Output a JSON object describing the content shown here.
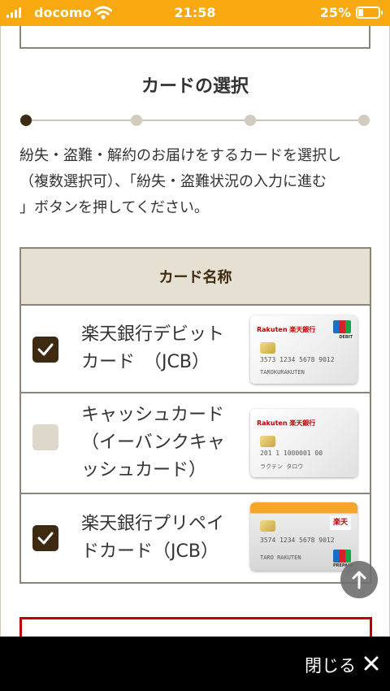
{
  "status_bar": {
    "carrier": "docomo",
    "time": "21:58",
    "battery_percent": "25%",
    "battery_level": 0.25,
    "accent_color": "#f8a90f"
  },
  "page": {
    "section_title": "カードの選択",
    "stepper": {
      "total_steps": 4,
      "current_step": 1
    },
    "instructions": [
      "紛失・盗難・解約のお届けをするカードを選択し",
      "（複数選択可）、「紛失・盗難状況の入力に進む",
      "」ボタンを押してください。"
    ]
  },
  "card_table": {
    "header": "カード名称",
    "rows": [
      {
        "name_lines": [
          "楽天銀行デビット",
          "カード　（JCB）"
        ],
        "checked": true,
        "card": {
          "brand_text": "Rakuten 楽天銀行",
          "number": "3573 1234 5678 9012",
          "holder": "TAROKURAKUTEN",
          "network": "JCB",
          "tag": "DEBIT"
        }
      },
      {
        "name_lines": [
          "キャッシュカード",
          "（イーバンクキャ",
          "ッシュカード）"
        ],
        "checked": false,
        "card": {
          "brand_text": "Rakuten 楽天銀行",
          "number": "201 1 1000001 00",
          "holder": "ラクテン タロウ"
        }
      },
      {
        "name_lines": [
          "楽天銀行プリペイ",
          "ドカード（JCB）"
        ],
        "checked": true,
        "card": {
          "brand_text": "楽天",
          "number": "3574 1234 5678 9012",
          "holder": "TARO RAKUTEN",
          "network": "JCB",
          "tag": "PREPAID"
        }
      }
    ]
  },
  "bottom_bar": {
    "close_label": "閉じる"
  },
  "colors": {
    "checked": "#3d2a10",
    "unchecked": "#ddd7cc",
    "header_bg": "#e6e0d3",
    "cta_border": "#c00000"
  }
}
